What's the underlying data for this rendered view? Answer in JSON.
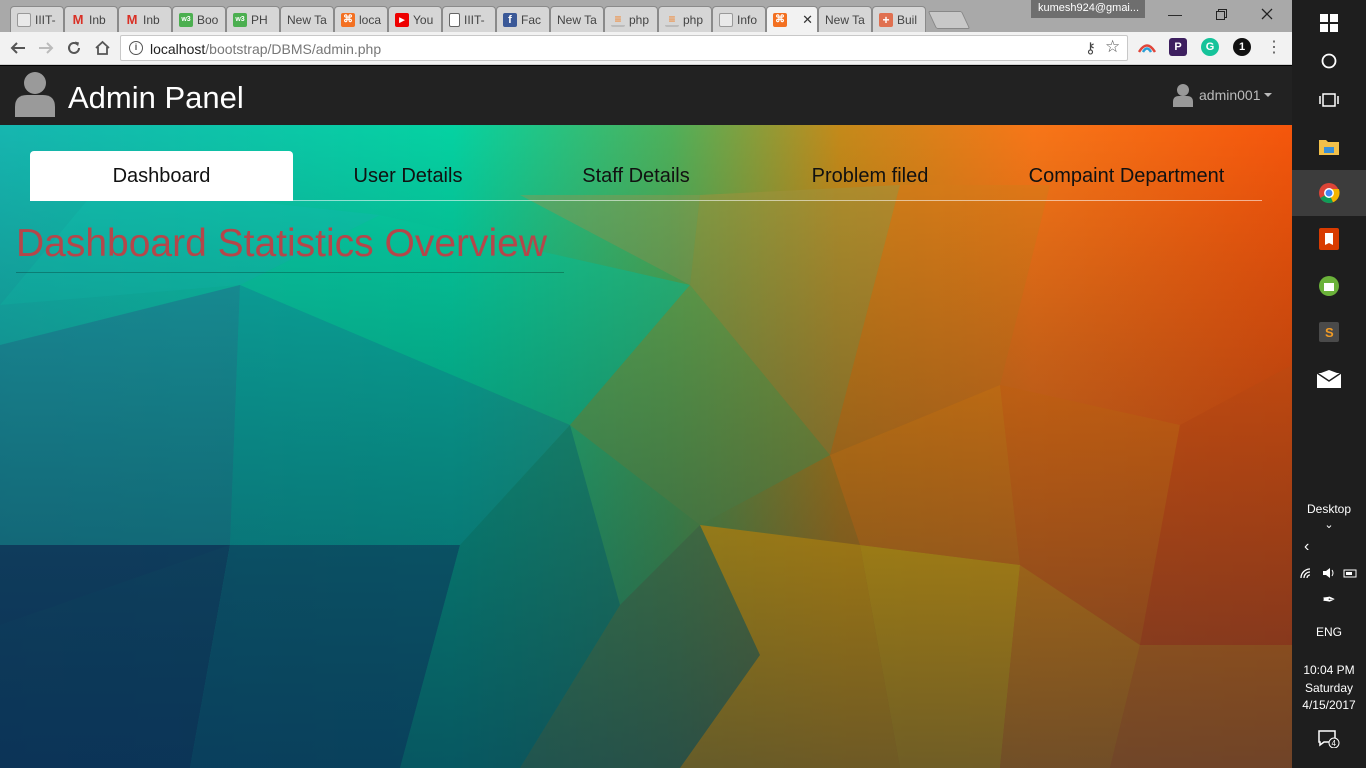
{
  "browser": {
    "tabs": [
      {
        "label": "IIIT-",
        "icon": "bookpock-icon",
        "color": "#e9e9e9"
      },
      {
        "label": "Inb",
        "icon": "gmail-icon",
        "color": "#d93025"
      },
      {
        "label": "Inb",
        "icon": "gmail-icon",
        "color": "#d93025"
      },
      {
        "label": "Boo",
        "icon": "w3schools-icon",
        "color": "#4caf50"
      },
      {
        "label": "PH",
        "icon": "w3schools-icon",
        "color": "#4caf50"
      },
      {
        "label": "New Ta",
        "icon": "",
        "color": ""
      },
      {
        "label": "loca",
        "icon": "xampp-icon",
        "color": "#f37021"
      },
      {
        "label": "You",
        "icon": "youtube-icon",
        "color": "#e00"
      },
      {
        "label": "IIIT-",
        "icon": "document-icon",
        "color": ""
      },
      {
        "label": "Fac",
        "icon": "facebook-icon",
        "color": "#3b5998"
      },
      {
        "label": "New Ta",
        "icon": "",
        "color": ""
      },
      {
        "label": "php",
        "icon": "stackoverflow-icon",
        "color": "#f48024"
      },
      {
        "label": "php",
        "icon": "stackoverflow-icon",
        "color": "#f48024"
      },
      {
        "label": "Info",
        "icon": "bookpock-icon",
        "color": "#e9e9e9"
      },
      {
        "label": "",
        "icon": "xampp-icon",
        "color": "#f37021",
        "active": true
      },
      {
        "label": "New Ta",
        "icon": "",
        "color": ""
      },
      {
        "label": "Buil",
        "icon": "plus-icon",
        "color": "#e07050"
      }
    ],
    "profile": "kumesh924@gmai...",
    "url_domain": "localhost",
    "url_path": "/bootstrap/DBMS/admin.php"
  },
  "page": {
    "brand": "Admin Panel",
    "user": "admin001",
    "nav_tabs": [
      "Dashboard",
      "User Details",
      "Staff Details",
      "Problem filed",
      "Compaint Department"
    ],
    "active_tab": "Dashboard",
    "heading": "Dashboard Statistics Overview",
    "heading_color": "#b5464a"
  },
  "taskbar": {
    "desktop_label": "Desktop",
    "language": "ENG",
    "time": "10:04 PM",
    "day": "Saturday",
    "date": "4/15/2017",
    "notifications": "4"
  }
}
